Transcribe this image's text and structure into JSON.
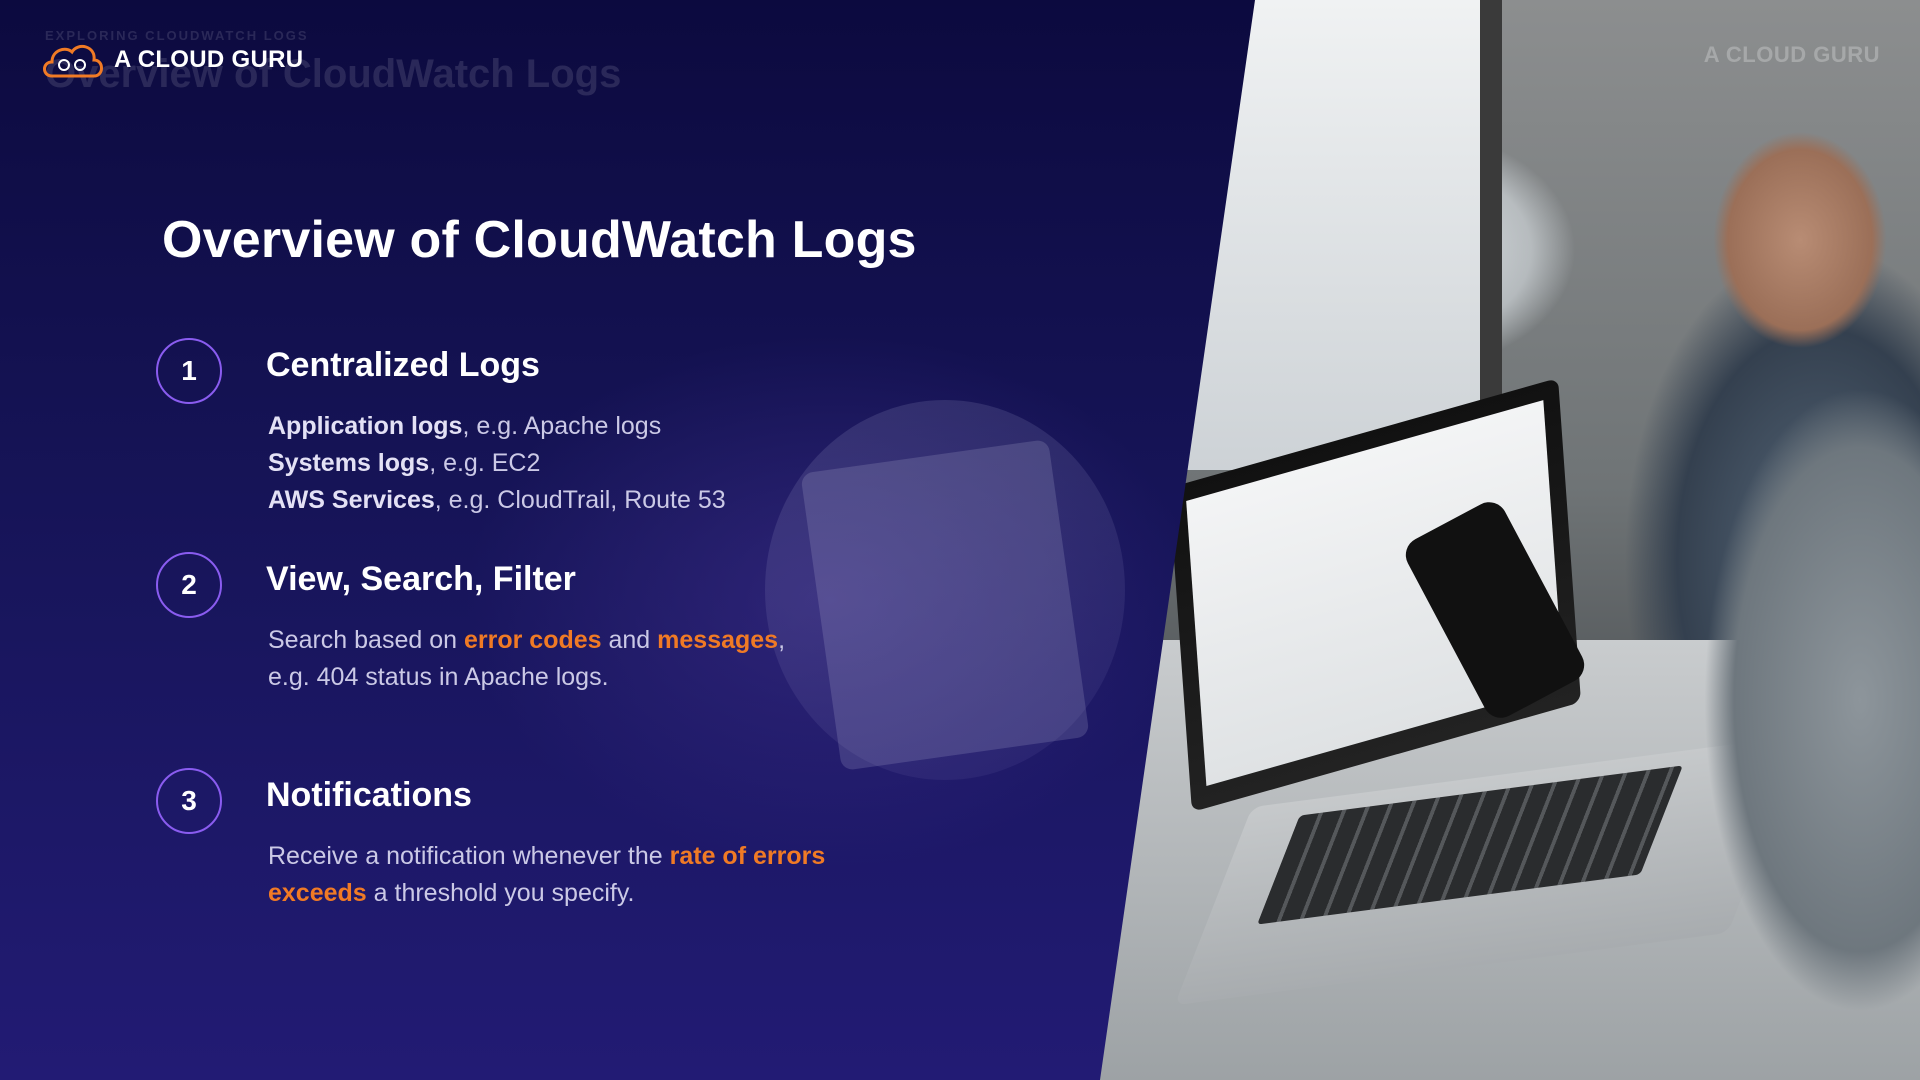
{
  "brand": {
    "name": "A CLOUD GURU",
    "watermark": "A CLOUD GURU",
    "colors": {
      "accent": "#f07a25",
      "ring": "#8a5cf0",
      "background": "#161457"
    }
  },
  "ghost": {
    "breadcrumb": "EXPLORING CLOUDWATCH LOGS",
    "title": "Overview of CloudWatch Logs"
  },
  "slide": {
    "title": "Overview of CloudWatch Logs",
    "items": [
      {
        "number": "1",
        "title": "Centralized Logs",
        "lines": [
          {
            "bold": "Application logs",
            "rest": ", e.g. Apache logs"
          },
          {
            "bold": "Systems logs",
            "rest": ", e.g. EC2"
          },
          {
            "bold": "AWS Services",
            "rest": ", e.g. CloudTrail, Route 53"
          }
        ]
      },
      {
        "number": "2",
        "title": "View, Search, Filter",
        "line1": {
          "pre": "Search based on ",
          "hl1": "error codes",
          "mid": " and ",
          "hl2": "messages",
          "post": ","
        },
        "line2": "e.g. 404 status in Apache logs."
      },
      {
        "number": "3",
        "title": "Notifications",
        "line1": {
          "pre": "Receive a notification whenever the ",
          "hl": "rate of errors"
        },
        "line2": {
          "hl": "exceeds",
          "post": " a threshold you specify."
        }
      }
    ]
  }
}
